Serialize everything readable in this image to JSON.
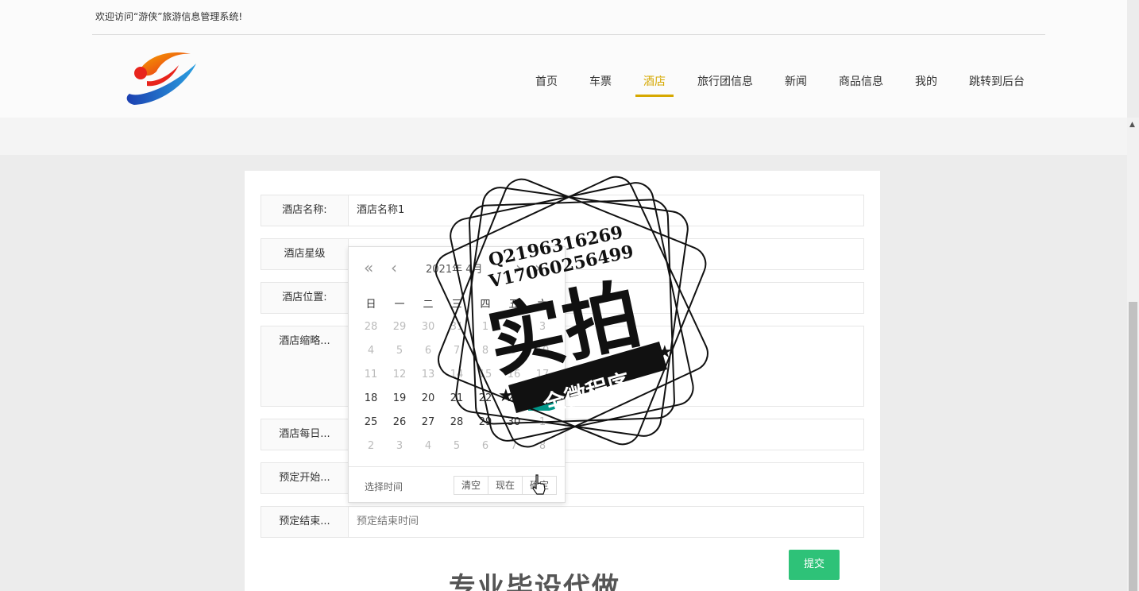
{
  "topbar": {
    "welcome": "欢迎访问“游侠”旅游信息管理系统!"
  },
  "nav": {
    "items": [
      {
        "label": "首页"
      },
      {
        "label": "车票"
      },
      {
        "label": "酒店"
      },
      {
        "label": "旅行团信息"
      },
      {
        "label": "新闻"
      },
      {
        "label": "商品信息"
      },
      {
        "label": "我的"
      },
      {
        "label": "跳转到后台"
      }
    ],
    "active_index": 2,
    "active_color": "#d6a800"
  },
  "form": {
    "hotel_name_label": "酒店名称:",
    "hotel_name_value": "酒店名称1",
    "hotel_star_label": "酒店星级",
    "hotel_location_label": "酒店位置:",
    "hotel_thumb_label": "酒店缩略...",
    "hotel_daily_label": "酒店每日...",
    "start_label": "预定开始...",
    "end_label": "预定结束...",
    "end_placeholder": "预定结束时间",
    "submit_label": "提交",
    "submit_color": "#2ec278"
  },
  "calendar": {
    "year": "2021年",
    "month": "4月",
    "weekdays": [
      "日",
      "一",
      "二",
      "三",
      "四",
      "五",
      "六"
    ],
    "days": [
      [
        "28",
        "29",
        "30",
        "31",
        "1",
        "2",
        "3"
      ],
      [
        "4",
        "5",
        "6",
        "7",
        "8",
        "9",
        "10"
      ],
      [
        "11",
        "12",
        "13",
        "14",
        "15",
        "16",
        "17"
      ],
      [
        "18",
        "19",
        "20",
        "21",
        "22",
        "23",
        "24"
      ],
      [
        "25",
        "26",
        "27",
        "28",
        "29",
        "30",
        "1"
      ],
      [
        "2",
        "3",
        "4",
        "5",
        "6",
        "7",
        "8"
      ]
    ],
    "muted": [
      [
        true,
        true,
        true,
        true,
        true,
        true,
        true
      ],
      [
        true,
        true,
        true,
        true,
        true,
        true,
        true
      ],
      [
        true,
        true,
        true,
        true,
        true,
        true,
        true
      ],
      [
        false,
        false,
        false,
        false,
        false,
        false,
        false
      ],
      [
        false,
        false,
        false,
        false,
        false,
        false,
        true
      ],
      [
        true,
        true,
        true,
        true,
        true,
        true,
        true
      ]
    ],
    "selected": [
      3,
      6
    ],
    "selected_color": "#009688",
    "footer_tip": "选择时间",
    "clear_label": "清空",
    "now_label": "现在",
    "confirm_label": "确定"
  },
  "watermark": {
    "line1": "Q2196316269",
    "line2": "V17060256499",
    "big_text": "实拍",
    "ribbon_text": "全微程序",
    "bottom_text": "专业毕设代做"
  }
}
